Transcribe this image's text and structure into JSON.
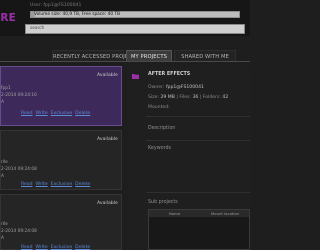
{
  "header": {
    "logo_text": "RE",
    "user_line": "User: fpp1@FS100041",
    "volume_text": "Volume size: 40,9 TB, Free space: 40 TB",
    "volume_used_fraction": 0.02,
    "search_placeholder": "search"
  },
  "tabs": [
    {
      "label": "RECENTLY ACCESSED PROJECTS",
      "active": false
    },
    {
      "label": "MY PROJECTS",
      "active": true
    },
    {
      "label": "SHARED WITH ME",
      "active": false
    }
  ],
  "projects": [
    {
      "selected": true,
      "status": "Available",
      "lines": [
        "fpp1",
        "",
        "",
        "2-2014 09:24:16",
        "A"
      ],
      "actions": [
        "Read",
        "Write",
        "Exclusive",
        "Delete"
      ]
    },
    {
      "selected": false,
      "status": "Available",
      "lines": [
        "rlle",
        "",
        "2-2014 09:24:08",
        "A"
      ],
      "actions": [
        "Read",
        "Write",
        "Exclusive",
        "Delete"
      ]
    },
    {
      "selected": false,
      "status": "Available",
      "lines": [
        "rlle",
        "",
        "2-2014 09:24:08",
        "A"
      ],
      "actions": [
        "Read",
        "Write",
        "Exclusive",
        "Delete"
      ]
    }
  ],
  "detail": {
    "name": "AFTER EFFECTS",
    "owner_label": "Owner:",
    "owner": "fpp1@FS100041",
    "size_label": "Size:",
    "size": "29 MB",
    "files_label": "Files:",
    "files": "36",
    "folders_label": "Folders:",
    "folders": "42",
    "mounted_label": "Mounted:",
    "description_label": "Description",
    "keywords_label": "Keywords",
    "subprojects_label": "Sub projects",
    "sub_columns": [
      "Name",
      "Mount location"
    ]
  },
  "colors": {
    "accent": "#9b2fa8",
    "selected_card": "#3e2a5a",
    "link": "#5d8ad8"
  }
}
